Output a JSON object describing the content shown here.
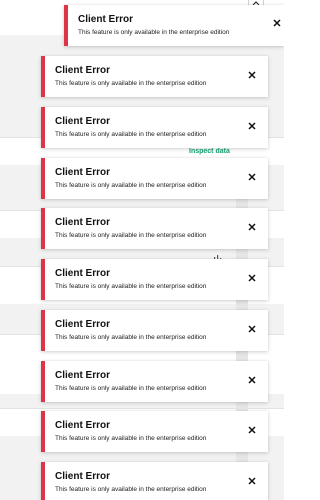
{
  "background": {
    "inspect_link": "Inspect data",
    "top_button_icon": "chevron-up-icon",
    "chart_icon": "bar-chart-icon"
  },
  "colors": {
    "error_accent": "#dc3545",
    "link_green": "#14a36f"
  },
  "toasts": [
    {
      "title": "Client Error",
      "message": "This feature is only available in the enterprise edition",
      "close_icon": "close-icon"
    },
    {
      "title": "Client Error",
      "message": "This feature is only available in the enterprise edition",
      "close_icon": "close-icon"
    },
    {
      "title": "Client Error",
      "message": "This feature is only available in the enterprise edition",
      "close_icon": "close-icon"
    },
    {
      "title": "Client Error",
      "message": "This feature is only available in the enterprise edition",
      "close_icon": "close-icon"
    },
    {
      "title": "Client Error",
      "message": "This feature is only available in the enterprise edition",
      "close_icon": "close-icon"
    },
    {
      "title": "Client Error",
      "message": "This feature is only available in the enterprise edition",
      "close_icon": "close-icon"
    },
    {
      "title": "Client Error",
      "message": "This feature is only available in the enterprise edition",
      "close_icon": "close-icon"
    },
    {
      "title": "Client Error",
      "message": "This feature is only available in the enterprise edition",
      "close_icon": "close-icon"
    },
    {
      "title": "Client Error",
      "message": "This feature is only available in the enterprise edition",
      "close_icon": "close-icon"
    },
    {
      "title": "Client Error",
      "message": "This feature is only available in the enterprise edition",
      "close_icon": "close-icon"
    }
  ]
}
